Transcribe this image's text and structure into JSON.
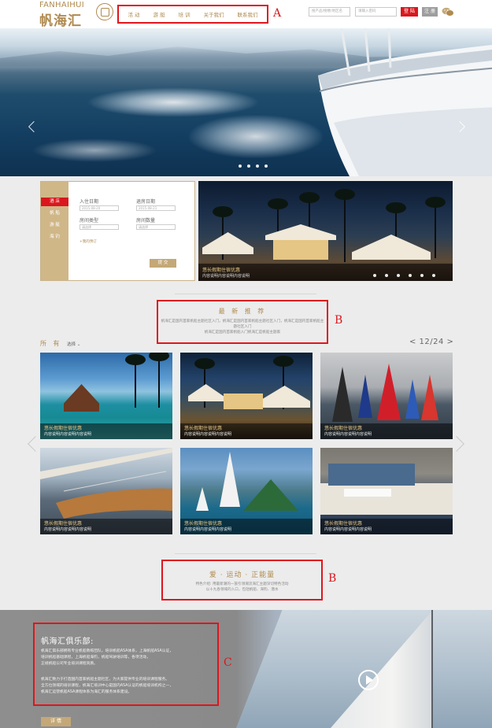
{
  "header": {
    "logo_en": "FANHAIHUI",
    "logo_cn": "帆海汇",
    "nav": [
      "活 动",
      "游 艇",
      "培 训",
      "关于我们",
      "联系我们"
    ],
    "search_placeholder_1": "搜产品/搜楼/地区名",
    "search_placeholder_2": "请输入密码",
    "login_label": "登 陆",
    "register_label": "注 册",
    "annotation_a": "A"
  },
  "hero": {
    "slide_count": 4
  },
  "booking": {
    "tabs": [
      "酒 店",
      "帆 船",
      "游 艇",
      "海 钓"
    ],
    "checkin_label": "入住日期",
    "checkout_label": "退房日期",
    "checkin_value": "2015-08-20",
    "checkout_value": "2015-08-21",
    "room_type_label": "房间类型",
    "room_count_label": "房间数量",
    "room_type_value": "请选择",
    "room_count_value": "请选择",
    "more_link": "+我的预订",
    "submit_label": "提 交"
  },
  "resort": {
    "title": "悠长假期住宿优惠",
    "subtitle": "内容说明内容说明内容说明",
    "dot_count": 6
  },
  "recommend": {
    "title": "最 新 推 荐",
    "desc_line1": "帆海汇是国内首家帆船主题社区入门，帆海汇是国内首家帆船主题社区入门，帆海汇是国内首家帆船主题社区入门",
    "desc_line2": "帆海汇是国内首家帆船入门帆海汇是帆船主题家",
    "annotation_b": "B"
  },
  "filter": {
    "all_label": "所 有",
    "option_label": "选择 ⌄",
    "pager": "< 12/24 >"
  },
  "cards": [
    {
      "title": "悠长假期住宿优惠",
      "sub": "内容说明内容说明内容说明"
    },
    {
      "title": "悠长假期住宿优惠",
      "sub": "内容说明内容说明内容说明"
    },
    {
      "title": "悠长假期住宿优惠",
      "sub": "内容说明内容说明内容说明"
    },
    {
      "title": "悠长假期住宿优惠",
      "sub": "内容说明内容说明内容说明"
    },
    {
      "title": "悠长假期住宿优惠",
      "sub": "内容说明内容说明内容说明"
    },
    {
      "title": "悠长假期住宿优惠",
      "sub": "内容说明内容说明内容说明"
    }
  ],
  "sport": {
    "title": "爱 · 运动 · 正能量",
    "desc_line1": "特色介绍: 用最新潮的一族引领潮流海汇主题深切特色活动",
    "desc_line2": "以十九各领域的入口，包括帆船、海钓、潜水",
    "annotation_b": "B"
  },
  "club": {
    "title": "帆海汇俱乐部:",
    "para1": [
      "帆海汇俱乐部拥有专业帆船教练团队，培训帆船ASA体系，上海帆船ASA认证，",
      "培训帆船基础课程，上海帆船海钓，帆船驾驶培训等，各项活动，",
      "正规帆船公司专业培训课程资质。"
    ],
    "para2": [
      "帆海汇致力于打造国内首家帆船主题社区，为大家提供专业的培训课程服务。",
      "全方位领域的培训课程，帆海汇培训中心是国内ASA认证的帆船培训机构之一，",
      "帆海汇运营帆船ASA课程体系为海汇的服务体系建设。"
    ],
    "button": "详 情",
    "annotation_c": "C"
  }
}
